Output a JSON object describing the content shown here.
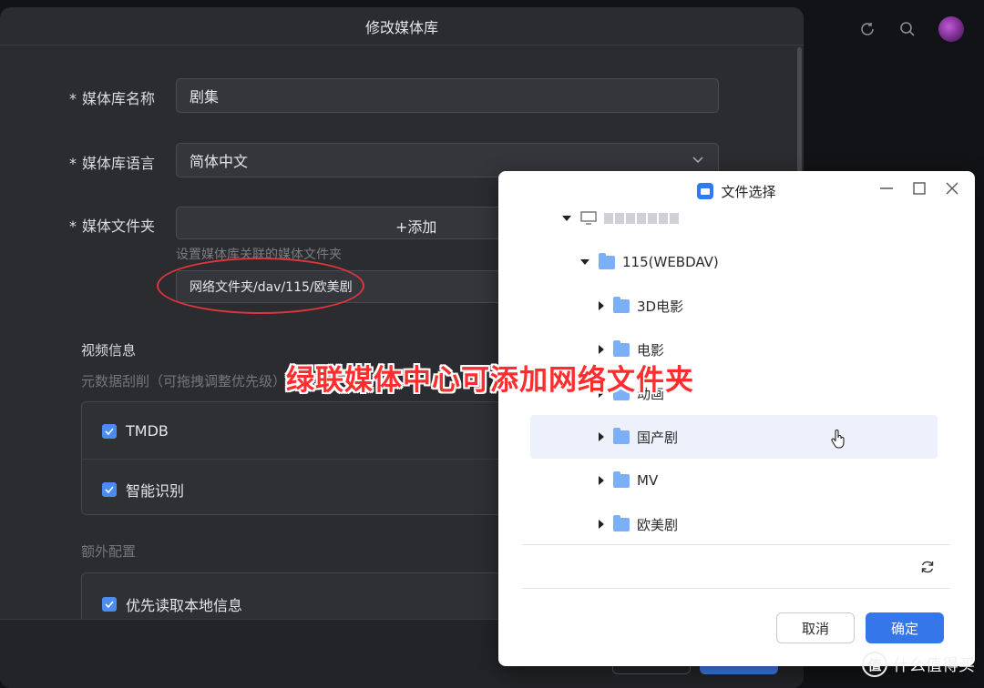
{
  "app": {
    "top_icons": [
      "refresh-icon",
      "search-icon",
      "avatar"
    ]
  },
  "dialog": {
    "title": "修改媒体库",
    "fields": {
      "name_label": "媒体库名称",
      "name_value": "剧集",
      "language_label": "媒体库语言",
      "language_value": "简体中文",
      "folder_label": "媒体文件夹",
      "add_button": "+添加",
      "folder_hint": "设置媒体库关联的媒体文件夹",
      "folder_path": "网络文件夹/dav/115/欧美剧"
    },
    "video_info": {
      "title": "视频信息",
      "subtitle": "元数据刮削（可拖拽调整优先级）",
      "items": [
        {
          "label": "TMDB",
          "checked": true
        },
        {
          "label": "智能识别",
          "checked": true
        }
      ]
    },
    "extra": {
      "title": "额外配置",
      "items": [
        {
          "label": "优先读取本地信息",
          "checked": true
        }
      ]
    }
  },
  "picker": {
    "title": "文件选择",
    "root": "115(WEBDAV)",
    "folders": [
      "3D电影",
      "电影",
      "动画",
      "国产剧",
      "MV",
      "欧美剧"
    ],
    "hovered": "国产剧",
    "cancel_label": "取消",
    "ok_label": "确定"
  },
  "annotation": {
    "text": "绿联媒体中心可添加网络文件夹"
  },
  "watermark": {
    "badge": "值",
    "text": "什么值得买"
  },
  "colors": {
    "accent": "#3f7be8",
    "annotation_red": "#e0353c",
    "folder_blue": "#7ab0f7"
  }
}
